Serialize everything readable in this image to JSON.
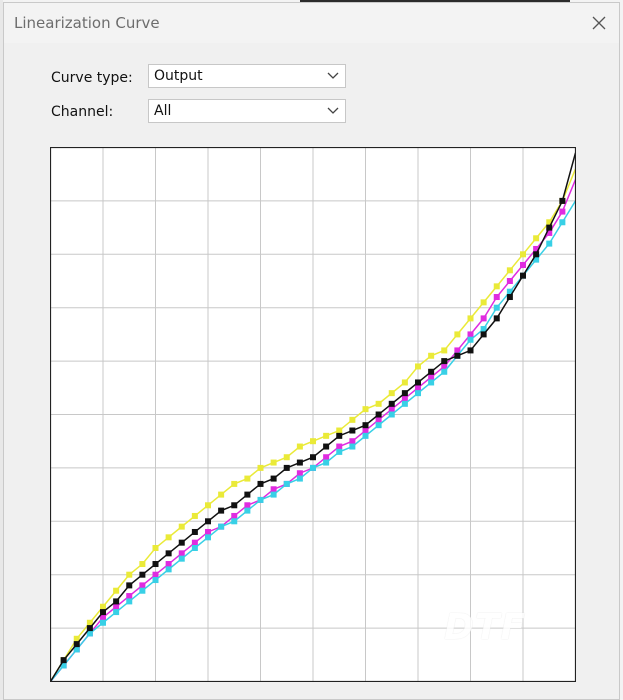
{
  "window": {
    "title": "Linearization Curve"
  },
  "icons": {
    "close": "close-icon",
    "dropdown": "chevron-down-icon"
  },
  "controls": {
    "curve_type": {
      "label": "Curve type:",
      "value": "Output"
    },
    "channel": {
      "label": "Channel:",
      "value": "All"
    }
  },
  "watermark": {
    "text": "DTF"
  },
  "colors": {
    "cyan": "#38d0e6",
    "magenta": "#e02be0",
    "yellow": "#eaea38",
    "black": "#111111",
    "grid": "#c8c8c8"
  },
  "chart_data": {
    "type": "line",
    "xlim": [
      0,
      100
    ],
    "ylim": [
      0,
      100
    ],
    "grid": true,
    "x": [
      0,
      2.5,
      5,
      7.5,
      10,
      12.5,
      15,
      17.5,
      20,
      22.5,
      25,
      27.5,
      30,
      32.5,
      35,
      37.5,
      40,
      42.5,
      45,
      47.5,
      50,
      52.5,
      55,
      57.5,
      60,
      62.5,
      65,
      67.5,
      70,
      72.5,
      75,
      77.5,
      80,
      82.5,
      85,
      87.5,
      90,
      92.5,
      95,
      97.5,
      100
    ],
    "series": [
      {
        "color": "yellow",
        "values": [
          0,
          4,
          8,
          11,
          14,
          17,
          20,
          22,
          25,
          27,
          29,
          31,
          33,
          35,
          37,
          38,
          40,
          41,
          42,
          44,
          45,
          46,
          47,
          49,
          51,
          52,
          54,
          56,
          59,
          61,
          62,
          65,
          68,
          71,
          74,
          77,
          80,
          83,
          86,
          90,
          96
        ]
      },
      {
        "color": "magenta",
        "values": [
          0,
          3,
          6,
          9,
          12,
          14,
          16,
          18,
          20,
          22,
          24,
          26,
          28,
          29,
          31,
          33,
          34,
          36,
          37,
          39,
          40,
          42,
          44,
          45,
          47,
          49,
          51,
          53,
          55,
          57,
          59,
          62,
          65,
          68,
          72,
          75,
          78,
          81,
          84,
          88,
          94
        ]
      },
      {
        "color": "cyan",
        "values": [
          0,
          3,
          6,
          9,
          11,
          13,
          15,
          17,
          19,
          21,
          23,
          25,
          27,
          29,
          30,
          32,
          34,
          35,
          37,
          38,
          40,
          41,
          43,
          44,
          46,
          48,
          50,
          52,
          54,
          56,
          58,
          61,
          64,
          66,
          70,
          73,
          76,
          79,
          82,
          86,
          90
        ]
      },
      {
        "color": "black",
        "values": [
          0,
          4,
          7,
          10,
          13,
          15,
          18,
          20,
          22,
          24,
          26,
          28,
          30,
          32,
          33,
          35,
          37,
          38,
          40,
          41,
          42,
          44,
          46,
          47,
          48,
          50,
          52,
          54,
          56,
          58,
          60,
          61,
          62,
          65,
          68,
          72,
          76,
          80,
          85,
          90,
          99
        ]
      }
    ]
  }
}
